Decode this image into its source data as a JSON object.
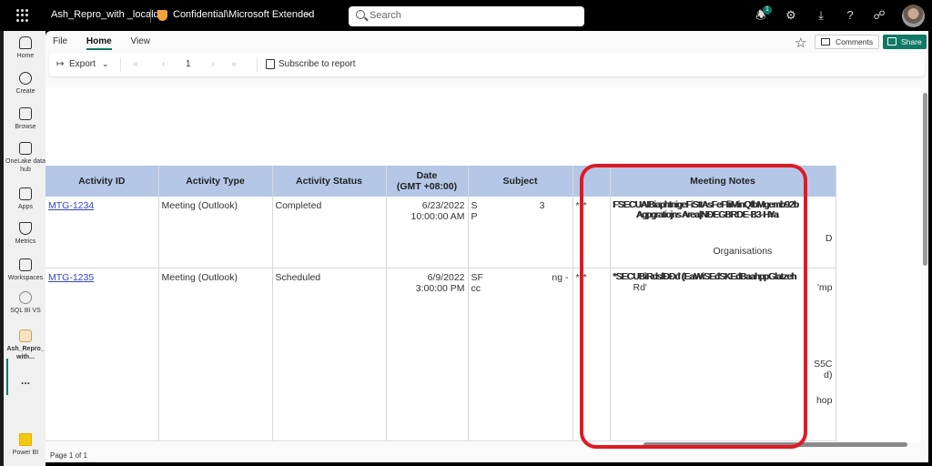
{
  "topbar": {
    "app_title": "Ash_Repro_with _localdb",
    "sensitivity_label": "Confidential\\Microsoft Extended",
    "search_placeholder": "Search",
    "notification_count": "1",
    "icons": [
      "waffle-icon",
      "sensitivity-shield-icon",
      "search-icon",
      "bell-icon",
      "gear-icon",
      "download-icon",
      "help-icon",
      "share-feedback-icon",
      "avatar"
    ]
  },
  "sidenav": {
    "items": [
      {
        "label": "Home",
        "icon": "home-icon"
      },
      {
        "label": "Create",
        "icon": "plus-circle-icon"
      },
      {
        "label": "Browse",
        "icon": "folder-icon"
      },
      {
        "label": "OneLake data hub",
        "icon": "database-icon"
      },
      {
        "label": "Apps",
        "icon": "apps-icon"
      },
      {
        "label": "Metrics",
        "icon": "trophy-icon"
      },
      {
        "label": "Workspaces",
        "icon": "workspaces-icon"
      },
      {
        "label": "SQL BI VS",
        "icon": "workspace-icon"
      },
      {
        "label": "Ash_Repro_ with...",
        "icon": "report-icon"
      },
      {
        "label": "...",
        "icon": "more-icon"
      },
      {
        "label": "Power BI",
        "icon": "powerbi-icon"
      }
    ]
  },
  "menu": {
    "tabs": [
      "File",
      "Home",
      "View"
    ],
    "active_tab": "Home",
    "comments_label": "Comments",
    "share_label": "Share"
  },
  "toolbar": {
    "export_label": "Export",
    "page_number": "1",
    "subscribe_label": "Subscribe to report"
  },
  "table": {
    "headers": [
      "Activity ID",
      "Activity Type",
      "Activity Status",
      "Date (GMT +08:00)",
      "Subject",
      "",
      "Meeting Notes"
    ],
    "header_date_line1": "Date",
    "header_date_line2": "(GMT +08:00)",
    "rows": [
      {
        "activity_id": "MTG-1234",
        "activity_type": "Meeting (Outlook)",
        "activity_status": "Completed",
        "date": "6/23/2022",
        "time": "10:00:00 AM",
        "subject_a": "S",
        "subject_b": "P",
        "subject_c": "3",
        "col6": "***",
        "notes_line1": "FSECUAIBiaphtnigeFiSttAsFeFfiiMinQfbMgemb92b",
        "notes_line2": "Agpgratiojns Area|NĐEGBRDE-B3-H¥a",
        "notes_line3": "D",
        "notes_line4": "Organisations"
      },
      {
        "activity_id": "MTG-1235",
        "activity_type": "Meeting (Outlook)",
        "activity_status": "Scheduled",
        "date": "6/9/2022",
        "time": "3:00:00 PM",
        "subject_a": "SF",
        "subject_b": "cc",
        "subject_c": "ng -",
        "col6": "***",
        "notes_line1": "*SECUBìRdsfÐĐđ (EaWiSEđSKEđBaahppGlatzeh",
        "notes_line2": "Rd'",
        "notes_line3": "'mp",
        "notes_line4": "S5C",
        "notes_line5": "d)",
        "notes_line6": "hop"
      }
    ]
  },
  "footer": {
    "page_status": "Page 1 of 1"
  },
  "annotation": {
    "highlight_color": "#e01a22",
    "highlight_target": "Meeting Notes"
  },
  "colors": {
    "brand": "#117865",
    "header_bg": "#b4c7e7",
    "link": "#3344cc"
  }
}
